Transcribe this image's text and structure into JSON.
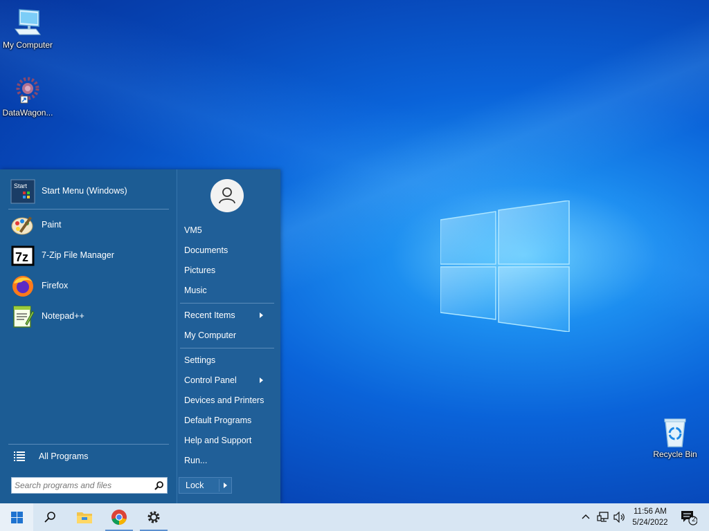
{
  "desktop": {
    "icons": [
      {
        "label": "My Computer"
      },
      {
        "label": "DataWagon..."
      },
      {
        "label": "Recycle Bin"
      }
    ]
  },
  "start_menu": {
    "pinned": [
      {
        "label": "Start Menu (Windows)",
        "icon": "start-menu-icon"
      },
      {
        "label": "Paint",
        "icon": "paint-icon"
      },
      {
        "label": "7-Zip File Manager",
        "icon": "7zip-icon"
      },
      {
        "label": "Firefox",
        "icon": "firefox-icon"
      },
      {
        "label": "Notepad++",
        "icon": "notepadpp-icon"
      }
    ],
    "start_icon_text": "Start",
    "sevenzip_icon_text": "7z",
    "all_programs": "All Programs",
    "search_placeholder": "Search programs and files",
    "user_name": "VM5",
    "right_items": [
      {
        "label": "VM5"
      },
      {
        "label": "Documents"
      },
      {
        "label": "Pictures"
      },
      {
        "label": "Music"
      },
      {
        "label": "Recent Items",
        "submenu": true
      },
      {
        "label": "My Computer"
      },
      {
        "label": "Settings"
      },
      {
        "label": "Control Panel",
        "submenu": true
      },
      {
        "label": "Devices and Printers"
      },
      {
        "label": "Default Programs"
      },
      {
        "label": "Help and Support"
      },
      {
        "label": "Run..."
      }
    ],
    "lock_label": "Lock"
  },
  "taskbar": {
    "clock_time": "11:56 AM",
    "clock_date": "5/24/2022",
    "notification_count": "2"
  },
  "colors": {
    "menu_bg": "#1c5c94",
    "taskbar_bg": "#d8e6f3",
    "accent": "#0a63d9"
  }
}
